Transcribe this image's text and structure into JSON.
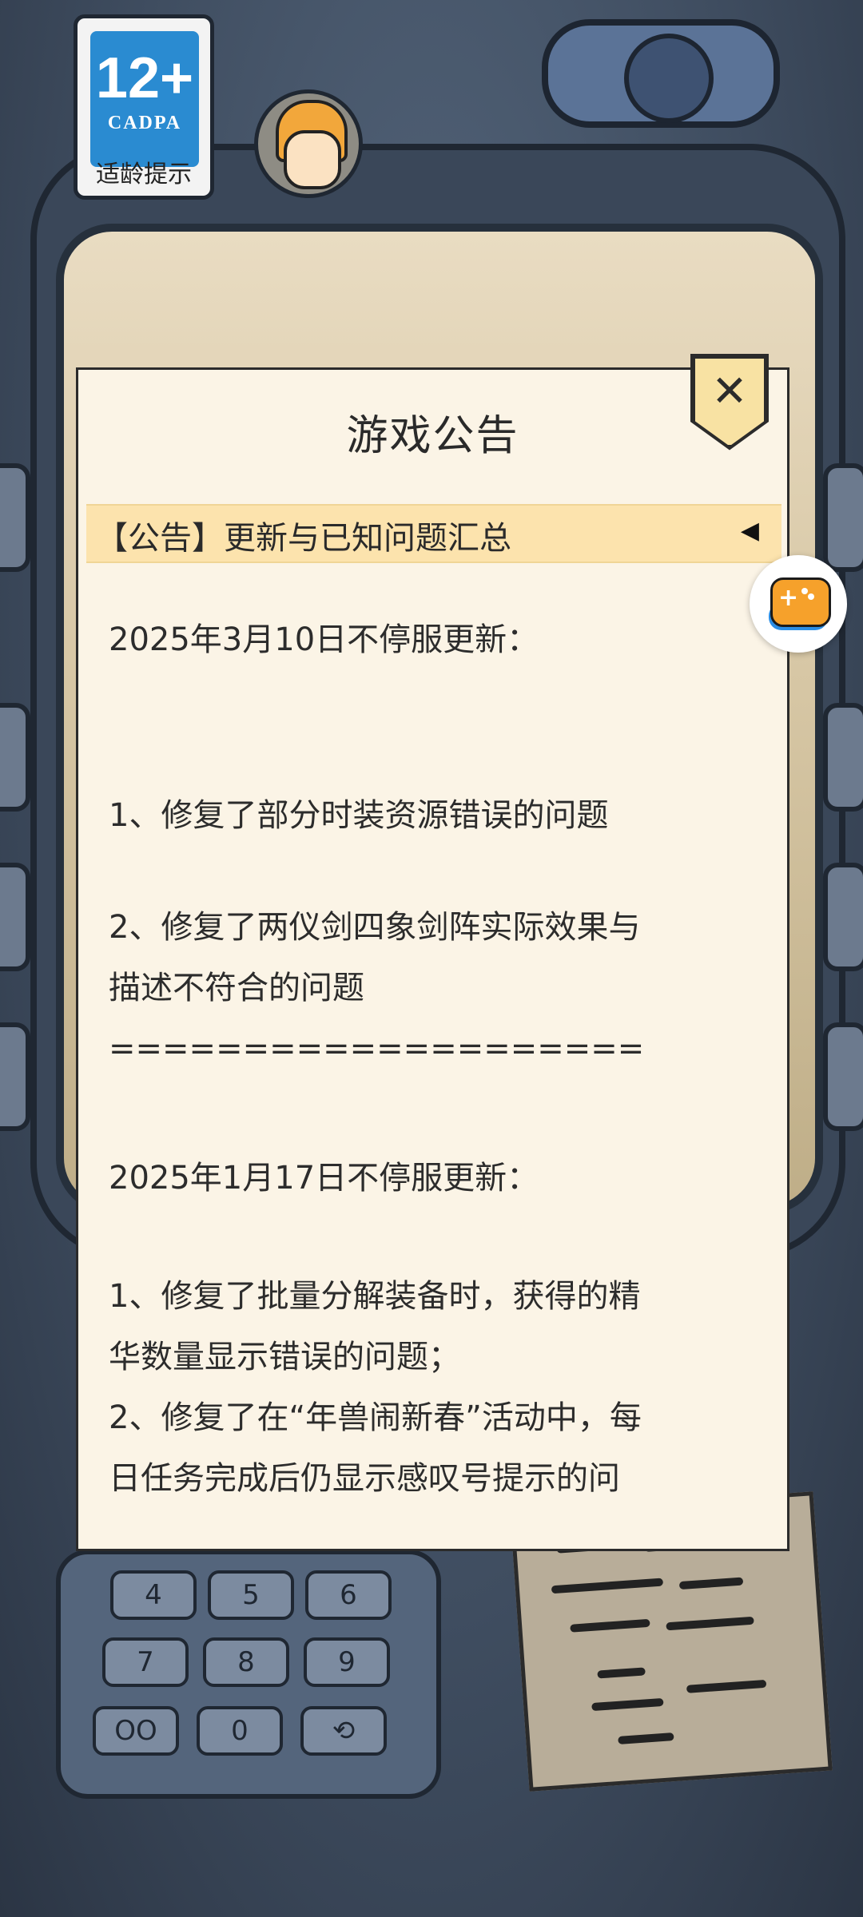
{
  "rating_badge": {
    "age": "12+",
    "org": "CADPA",
    "tip": "适龄提示"
  },
  "dialog": {
    "title": "游戏公告",
    "close_symbol": "✕",
    "notice_title": "【公告】更新与已知问题汇总",
    "collapse_arrow": "◀",
    "lines": [
      "2025年3月10日不停服更新：",
      "1、修复了部分时装资源错误的问题",
      "2、修复了两仪剑四象剑阵实际效果与",
      "描述不符合的问题",
      "====================",
      "2025年1月17日不停服更新：",
      "1、修复了批量分解装备时，获得的精",
      "华数量显示错误的问题；",
      "2、修复了在“年兽闹新春”活动中，每",
      "日任务完成后仍显示感叹号提示的问"
    ]
  },
  "keypad": {
    "keys": [
      "4",
      "5",
      "6",
      "7",
      "8",
      "9",
      "OO",
      "0",
      "⟲"
    ]
  },
  "icons": {
    "close": "close-icon",
    "collapse": "triangle-left-icon",
    "floating": "gamepad-icon",
    "avatar": "customer-service-avatar"
  },
  "colors": {
    "dialog_bg": "#fbf4e6",
    "notice_bg": "#fce3ad",
    "close_bg": "#f8e2a3",
    "badge_blue": "#2a8bd1"
  }
}
